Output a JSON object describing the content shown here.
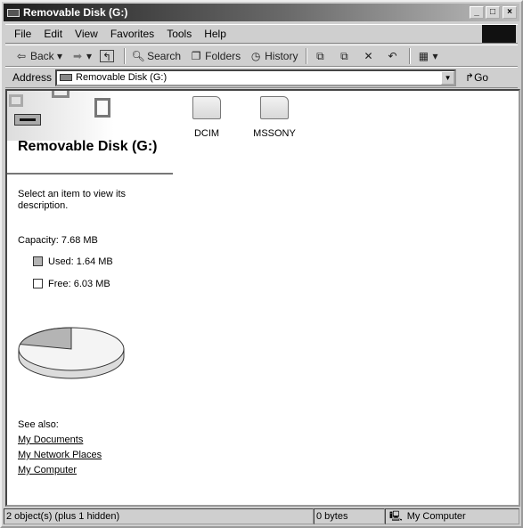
{
  "window": {
    "title": "Removable Disk (G:)"
  },
  "menu": [
    "File",
    "Edit",
    "View",
    "Favorites",
    "Tools",
    "Help"
  ],
  "toolbar": {
    "back": "Back",
    "search": "Search",
    "folders": "Folders",
    "history": "History"
  },
  "address": {
    "label": "Address",
    "value": "Removable Disk (G:)",
    "go": "Go"
  },
  "left": {
    "title": "Removable Disk (G:)",
    "hint": "Select an item to view its description.",
    "capacity": "Capacity: 7.68 MB",
    "used": "Used: 1.64 MB",
    "free": "Free: 6.03 MB",
    "see_also": "See also:",
    "links": [
      "My Documents",
      "My Network Places",
      "My Computer"
    ]
  },
  "disk_usage": {
    "used_mb": 1.64,
    "free_mb": 6.03,
    "colors": {
      "used": "#b4b4b4",
      "free": "#f4f4f4"
    }
  },
  "files": [
    "DCIM",
    "MSSONY"
  ],
  "status": {
    "objects": "2 object(s) (plus 1 hidden)",
    "size": "0 bytes",
    "zone": "My Computer"
  }
}
